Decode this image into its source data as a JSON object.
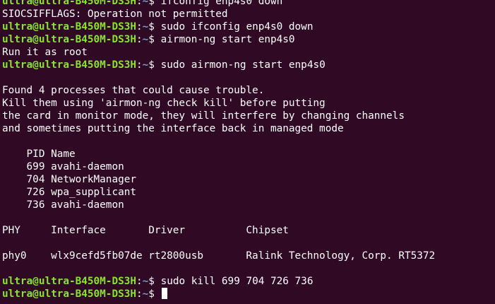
{
  "terminal": {
    "prompt": {
      "user_host": "ultra@ultra-B450M-DS3H",
      "separator": ":",
      "path": "~",
      "symbol": "$ "
    },
    "lines": [
      {
        "kind": "prompt",
        "command": "ifconfig enp4s0 down"
      },
      {
        "kind": "output",
        "text": "SIOCSIFFLAGS: Operation not permitted"
      },
      {
        "kind": "prompt",
        "command": "sudo ifconfig enp4s0 down"
      },
      {
        "kind": "prompt",
        "command": "airmon-ng start enp4s0"
      },
      {
        "kind": "output",
        "text": "Run it as root"
      },
      {
        "kind": "prompt",
        "command": "sudo airmon-ng start enp4s0"
      },
      {
        "kind": "output",
        "text": ""
      },
      {
        "kind": "output",
        "text": "Found 4 processes that could cause trouble."
      },
      {
        "kind": "output",
        "text": "Kill them using 'airmon-ng check kill' before putting"
      },
      {
        "kind": "output",
        "text": "the card in monitor mode, they will interfere by changing channels"
      },
      {
        "kind": "output",
        "text": "and sometimes putting the interface back in managed mode"
      },
      {
        "kind": "output",
        "text": ""
      },
      {
        "kind": "output",
        "text": "    PID Name"
      },
      {
        "kind": "output",
        "text": "    699 avahi-daemon"
      },
      {
        "kind": "output",
        "text": "    704 NetworkManager"
      },
      {
        "kind": "output",
        "text": "    726 wpa_supplicant"
      },
      {
        "kind": "output",
        "text": "    736 avahi-daemon"
      },
      {
        "kind": "output",
        "text": ""
      },
      {
        "kind": "output",
        "text": "PHY     Interface       Driver          Chipset"
      },
      {
        "kind": "output",
        "text": ""
      },
      {
        "kind": "output",
        "text": "phy0    wlx9cefd5fb07de rt2800usb       Ralink Technology, Corp. RT5372"
      },
      {
        "kind": "output",
        "text": ""
      },
      {
        "kind": "prompt",
        "command": "sudo kill 699 704 726 736"
      },
      {
        "kind": "prompt",
        "command": "",
        "cursor": true
      }
    ]
  },
  "colors": {
    "background": "#300a24",
    "text": "#ffffff",
    "prompt_user": "#8ae234",
    "prompt_path": "#729fcf"
  }
}
